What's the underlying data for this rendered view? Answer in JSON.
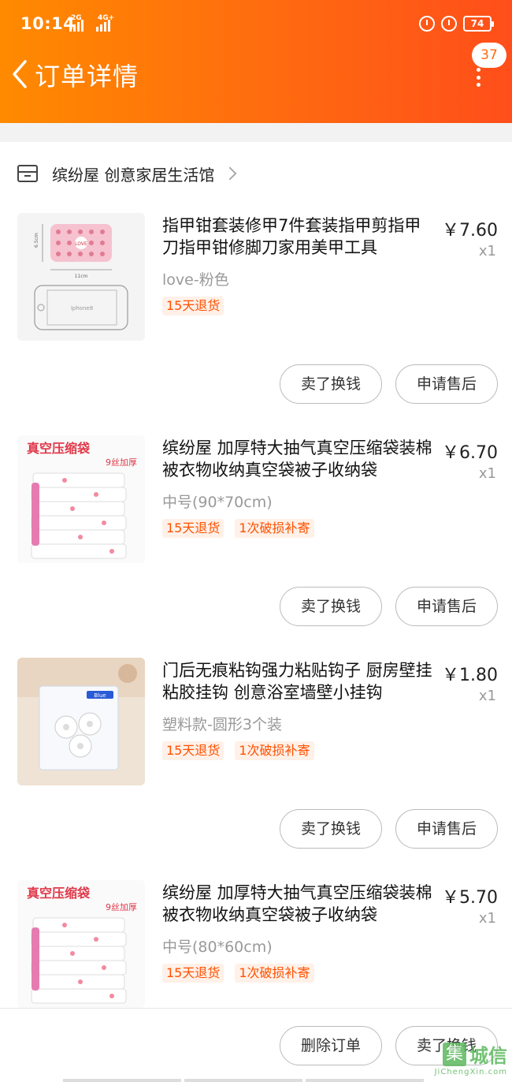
{
  "status_bar": {
    "time": "10:14",
    "signal_1": "2G",
    "signal_2": "4G+",
    "battery": "74"
  },
  "header": {
    "title": "订单详情",
    "badge_count": "37"
  },
  "shop": {
    "name": "缤纷屋 创意家居生活馆"
  },
  "items": [
    {
      "name": "指甲钳套装修甲7件套装指甲剪指甲刀指甲钳修脚刀家用美甲工具",
      "price": "￥7.60",
      "qty": "x1",
      "variant": "love-粉色",
      "tags": [
        "15天退货"
      ],
      "thumb_text": {
        "dim1": "6.5cm",
        "dim2": "11cm",
        "phone": "iphone8",
        "logo": "LOVE"
      },
      "actions": {
        "sell": "卖了换钱",
        "after_sale": "申请售后"
      }
    },
    {
      "name": "缤纷屋 加厚特大抽气真空压缩袋装棉被衣物收纳真空袋被子收纳袋",
      "price": "￥6.70",
      "qty": "x1",
      "variant": "中号(90*70cm)",
      "tags": [
        "15天退货",
        "1次破损补寄"
      ],
      "thumb_text": {
        "title": "真空压缩袋",
        "sub": "9丝加厚"
      },
      "actions": {
        "sell": "卖了换钱",
        "after_sale": "申请售后"
      }
    },
    {
      "name": "门后无痕粘钩强力粘贴钩子 厨房壁挂粘胶挂钩 创意浴室墙壁小挂钩",
      "price": "￥1.80",
      "qty": "x1",
      "variant": "塑料款-圆形3个装",
      "tags": [
        "15天退货",
        "1次破损补寄"
      ],
      "thumb_text": {
        "brand": "Blue"
      },
      "actions": {
        "sell": "卖了换钱",
        "after_sale": "申请售后"
      }
    },
    {
      "name": "缤纷屋 加厚特大抽气真空压缩袋装棉被衣物收纳真空袋被子收纳袋",
      "price": "￥5.70",
      "qty": "x1",
      "variant": "中号(80*60cm)",
      "tags": [
        "15天退货",
        "1次破损补寄"
      ],
      "thumb_text": {
        "title": "真空压缩袋",
        "sub": "9丝加厚"
      }
    }
  ],
  "bottom_bar": {
    "delete": "删除订单",
    "sell": "卖了换钱"
  },
  "watermark": {
    "logo": "集",
    "text": "城信",
    "sub": "JiChengXin.com"
  },
  "colors": {
    "header_start": "#ff8a00",
    "header_end": "#ff4e1a",
    "tag_text": "#ff5000",
    "tag_bg": "#fff1e8"
  }
}
